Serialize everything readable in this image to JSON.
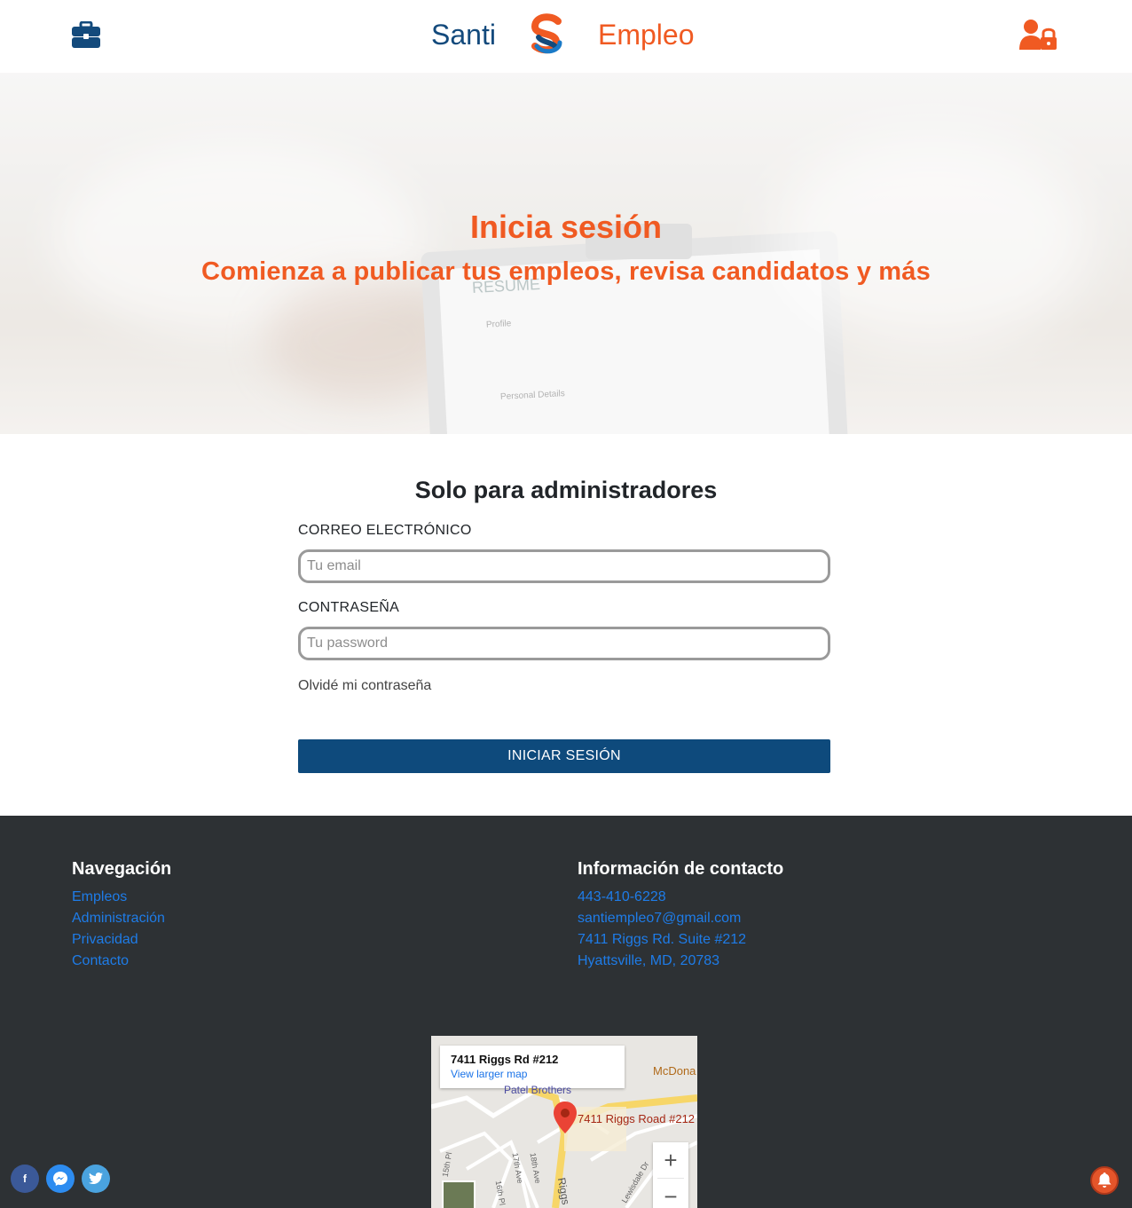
{
  "header": {
    "brand_left": "Santi",
    "brand_right": "Empleo"
  },
  "hero": {
    "title": "Inicia sesión",
    "subtitle": "Comienza a publicar tus empleos, revisa candidatos y más",
    "paper_heading": "RESUME",
    "paper_profile": "Profile",
    "paper_personal": "Personal Details"
  },
  "form": {
    "title": "Solo para administradores",
    "email_label": "CORREO ELECTRÓNICO",
    "email_placeholder": "Tu email",
    "email_value": "",
    "password_label": "CONTRASEÑA",
    "password_placeholder": "Tu password",
    "password_value": "",
    "forgot_link": "Olvidé mi contraseña",
    "submit_label": "INICIAR SESIÓN"
  },
  "footer": {
    "nav_title": "Navegación",
    "nav_links": [
      "Empleos",
      "Administración",
      "Privacidad",
      "Contacto"
    ],
    "contact_title": "Información de contacto",
    "contact_lines": [
      "443-410-6228",
      "santiempleo7@gmail.com",
      "7411 Riggs Rd. Suite #212",
      "Hyattsville, MD, 20783"
    ]
  },
  "map": {
    "card_address": "7411 Riggs Rd #212",
    "card_link": "View larger map",
    "label_mcdonalds": "McDona",
    "label_patel": "Patel Brothers",
    "label_pin": "7411 Riggs Road #212",
    "label_riggs": "Riggs",
    "street_15th": "15th Pl",
    "street_16th": "16th Pl",
    "street_17th": "17th Ave",
    "street_18th": "18th Ave",
    "street_lewisdale": "Lewisdale Dr",
    "zoom_in": "+",
    "zoom_out": "−"
  },
  "social": {
    "facebook": "f"
  },
  "colors": {
    "brand_blue": "#134a7c",
    "brand_orange": "#f05a22",
    "button_blue": "#0e4a7c",
    "footer_bg": "#2d3134",
    "footer_link": "#1e7ce8"
  },
  "icons": [
    "briefcase-icon",
    "santi-logo-icon",
    "user-lock-icon",
    "facebook-icon",
    "messenger-icon",
    "twitter-icon",
    "bell-icon",
    "map-pin-icon"
  ]
}
